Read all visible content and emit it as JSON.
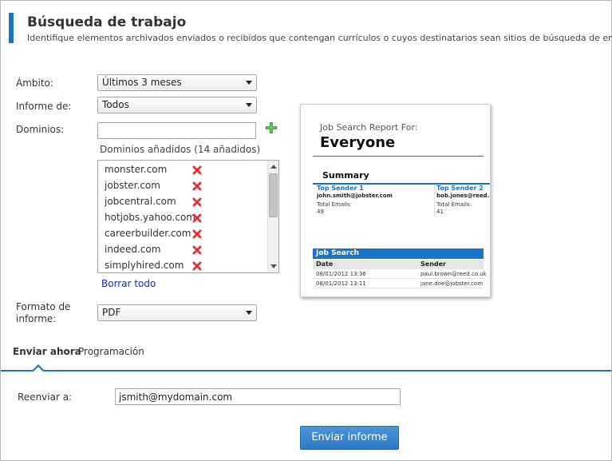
{
  "header": {
    "title": "Búsqueda de trabajo",
    "subtitle": "Identifique elementos archivados enviados o recibidos que contengan currículos o cuyos destinatarios sean sitios de búsqueda de empleo."
  },
  "form": {
    "scope_label": "Ámbito:",
    "scope_value": "Últimos 3 meses",
    "report_of_label": "Informe de:",
    "report_of_value": "Todos",
    "domains_label": "Dominios:",
    "domains_input_value": "",
    "added_domains_label": "Dominios añadidos (14 añadidos)",
    "domains": [
      "monster.com",
      "jobster.com",
      "jobcentral.com",
      "hotjobs.yahoo.com",
      "careerbuilder.com",
      "indeed.com",
      "simplyhired.com"
    ],
    "clear_all_label": "Borrar todo",
    "format_label_line1": "Formato de",
    "format_label_line2": "informe:",
    "format_value": "PDF"
  },
  "preview": {
    "heading": "Job Search Report For:",
    "who": "Everyone",
    "summary_title": "Summary",
    "senders": [
      {
        "title": "Top Sender 1",
        "email": "john.smith@jobster.com",
        "total_label": "Total Emails:",
        "total": "49"
      },
      {
        "title": "Top Sender 2",
        "email": "bob.jones@reed.",
        "total_label": "Total Emails:",
        "total": "41"
      }
    ],
    "table_title": "Job Search",
    "columns": [
      "Date",
      "Sender"
    ],
    "rows": [
      [
        "08/01/2012 13:36",
        "paul.brown@reed.co.uk"
      ],
      [
        "08/01/2012 13:11",
        "jane.doe@jobster.com"
      ]
    ]
  },
  "tabs": {
    "send_now": "Enviar ahora",
    "schedule": "Programación"
  },
  "send": {
    "forward_label": "Reenviar a:",
    "forward_value": "jsmith@mydomain.com",
    "submit_label": "Enviar informe"
  },
  "colors": {
    "accent": "#1a73c7",
    "link": "#1a2fa8",
    "delete": "#d9363e",
    "add": "#3aa52f"
  }
}
